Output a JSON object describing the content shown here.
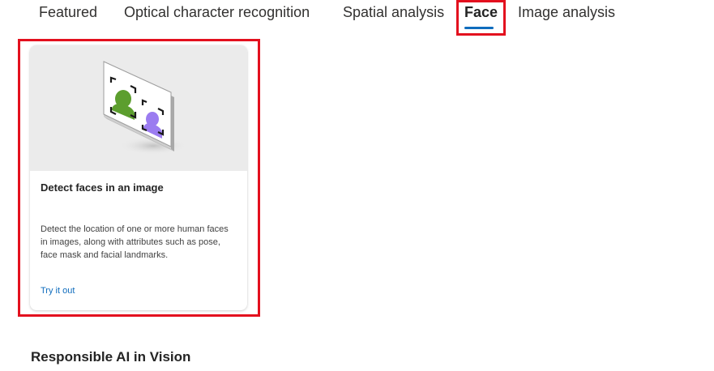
{
  "tabs": [
    {
      "label": "Featured"
    },
    {
      "label": "Optical character recognition"
    },
    {
      "label": "Spatial analysis"
    },
    {
      "label": "Face"
    },
    {
      "label": "Image analysis"
    }
  ],
  "active_tab": "Face",
  "card": {
    "title": "Detect faces in an image",
    "description": "Detect the location of one or more human faces in images, along with attributes such as pose, face mask and facial landmarks.",
    "link": "Try it out",
    "illustration": "face-detection-illustration"
  },
  "section": {
    "title": "Responsible AI in Vision"
  },
  "colors": {
    "accent": "#0f6cbd",
    "highlight": "#e3101e",
    "face_green": "#5c9e2e",
    "face_purple": "#9b7cf0"
  }
}
